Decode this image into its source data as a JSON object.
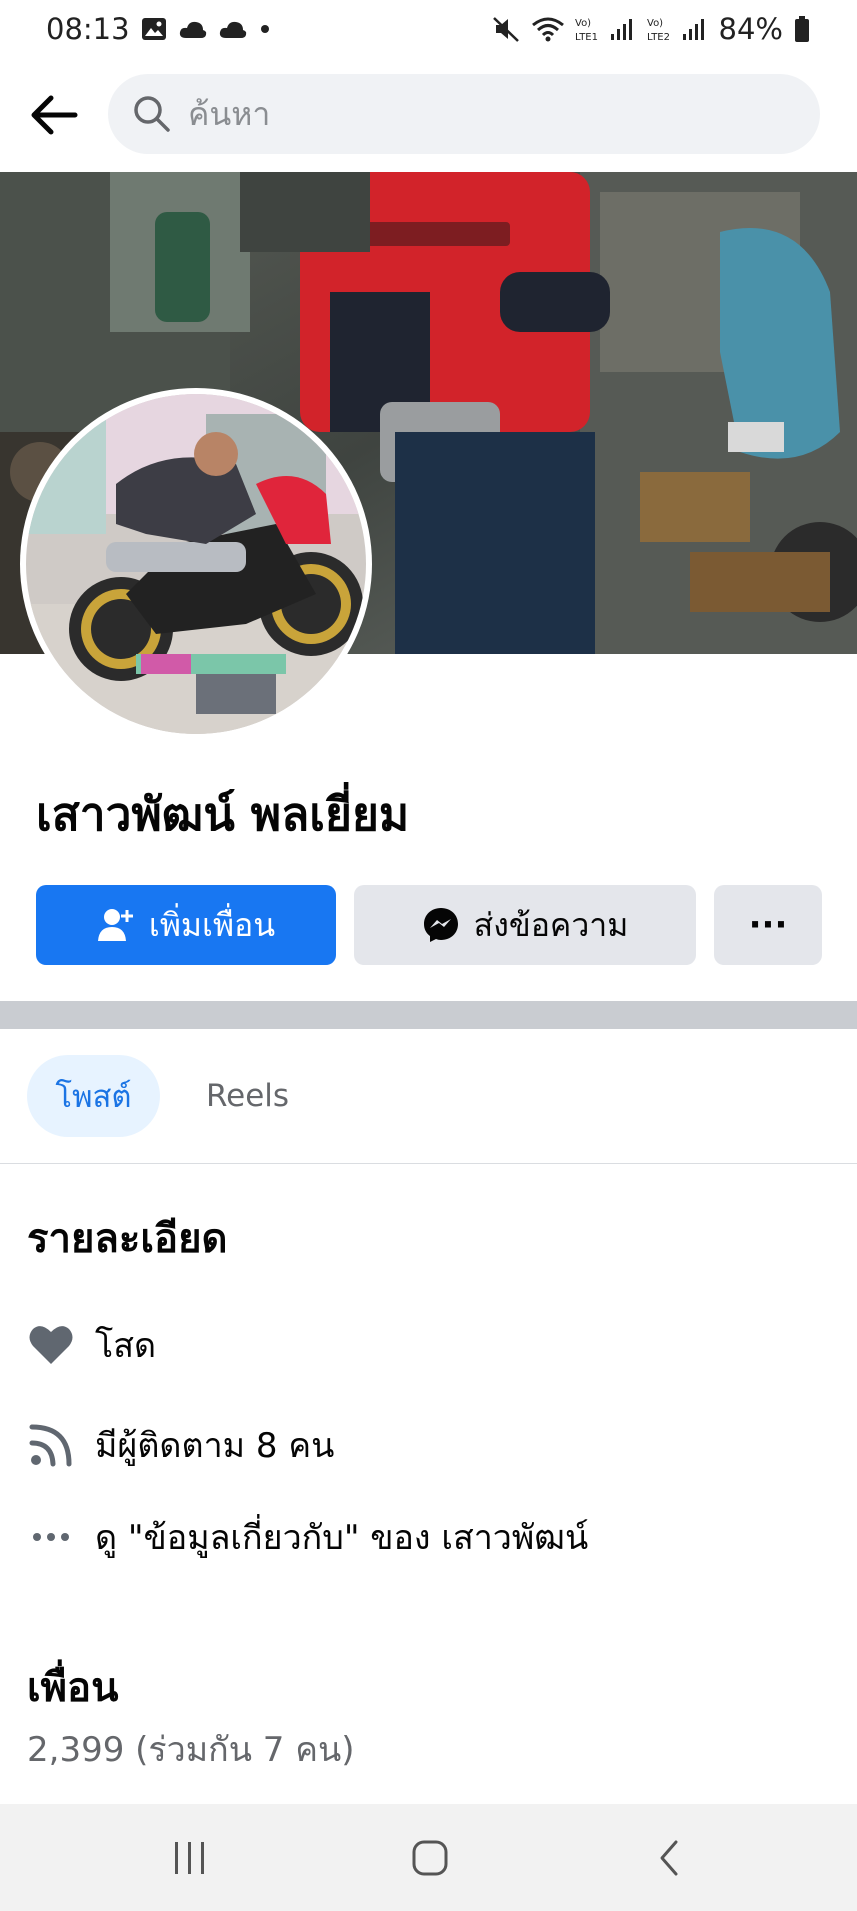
{
  "status_bar": {
    "time": "08:13",
    "battery": "84%",
    "sim1_label": "LTE1",
    "sim2_label": "LTE2"
  },
  "search": {
    "placeholder": "ค้นหา"
  },
  "profile": {
    "name": "เสาวพัฒน์ พลเยี่ยม"
  },
  "actions": {
    "add_friend_label": "เพิ่มเพื่อน",
    "message_label": "ส่งข้อความ",
    "more_label": "···"
  },
  "tabs": [
    {
      "label": "โพสต์",
      "active": true
    },
    {
      "label": "Reels",
      "active": false
    }
  ],
  "details": {
    "title": "รายละเอียด",
    "items": [
      {
        "icon": "heart-icon",
        "text": "โสด"
      },
      {
        "icon": "rss-followers-icon",
        "text": "มีผู้ติดตาม 8 คน"
      },
      {
        "icon": "more-dots-icon",
        "text": "ดู \"ข้อมูลเกี่ยวกับ\" ของ เสาวพัฒน์"
      }
    ]
  },
  "friends": {
    "title": "เพื่อน",
    "count_text": "2,399 (ร่วมกัน 7 คน)"
  },
  "colors": {
    "primary_blue": "#1877f2",
    "tab_active_bg": "#e7f3ff",
    "button_gray": "#e4e6eb",
    "divider_gray": "#c9ccd1"
  }
}
